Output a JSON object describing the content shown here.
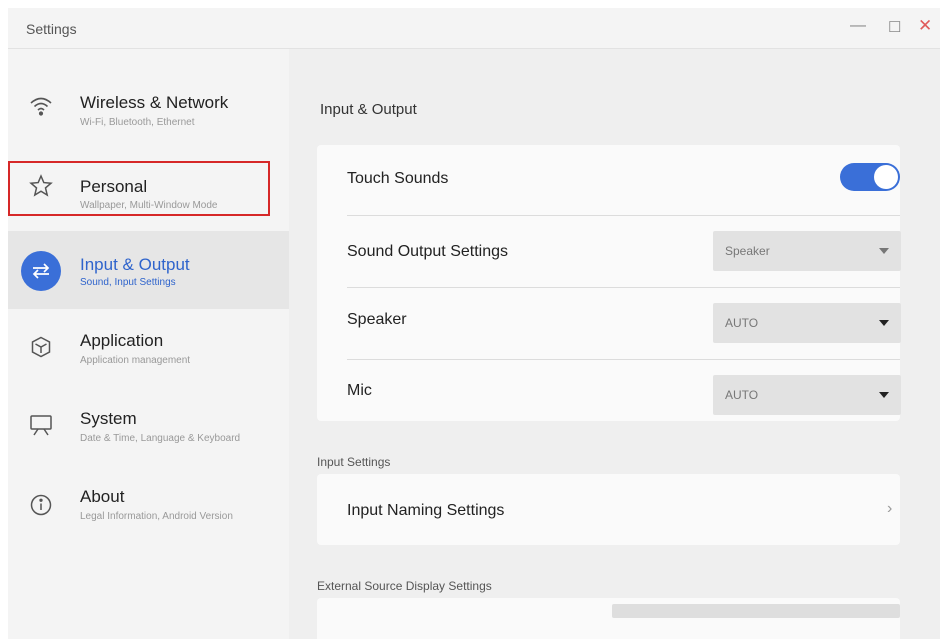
{
  "window": {
    "title": "Settings",
    "controls": {
      "minimize": "—",
      "maximize": "☐",
      "close": "✕"
    }
  },
  "sidebar": {
    "items": [
      {
        "title": "Wireless & Network",
        "subtitle": "Wi-Fi, Bluetooth, Ethernet",
        "icon": "wifi-icon"
      },
      {
        "title": "Personal",
        "subtitle": "Wallpaper, Multi-Window Mode",
        "icon": "star-icon"
      },
      {
        "title": "Input & Output",
        "subtitle": "Sound, Input Settings",
        "icon": "swap-arrows-icon",
        "active": true
      },
      {
        "title": "Application",
        "subtitle": "Application management",
        "icon": "cube-icon"
      },
      {
        "title": "System",
        "subtitle": "Date & Time, Language & Keyboard",
        "icon": "monitor-icon"
      },
      {
        "title": "About",
        "subtitle": "Legal Information, Android Version",
        "icon": "info-icon"
      }
    ],
    "highlight_color": "#d62828"
  },
  "content": {
    "title": "Input & Output",
    "sound": {
      "touch_sounds": {
        "label": "Touch Sounds",
        "on": true
      },
      "sound_output": {
        "label": "Sound Output Settings",
        "value": "Speaker"
      },
      "speaker": {
        "label": "Speaker",
        "value": "AUTO"
      },
      "mic": {
        "label": "Mic",
        "value": "AUTO"
      }
    },
    "input_settings": {
      "section_label": "Input Settings",
      "naming": {
        "label": "Input Naming Settings",
        "chevron": "›"
      }
    },
    "external": {
      "section_label": "External Source Display Settings"
    }
  },
  "colors": {
    "accent": "#3a6fd8",
    "background": "#efefef",
    "card": "#fafafa"
  }
}
